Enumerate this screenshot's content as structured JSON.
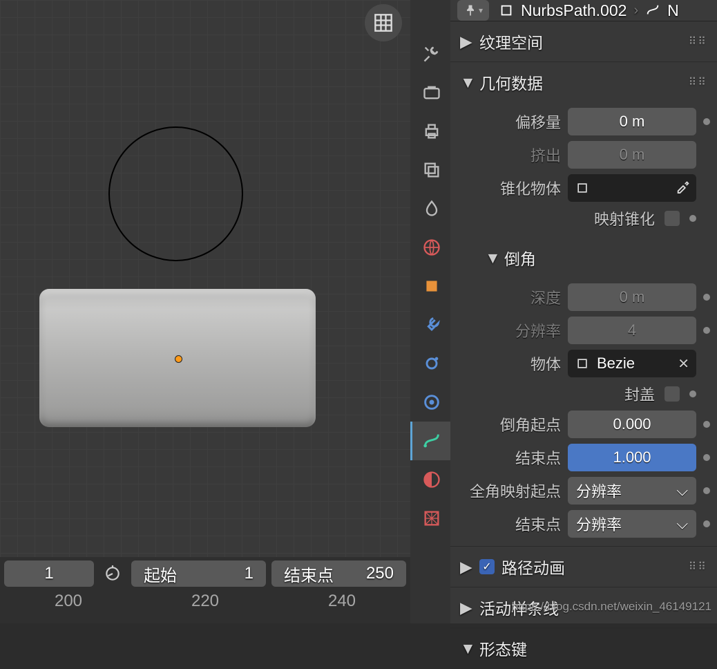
{
  "header": {
    "object_name": "NurbsPath.002",
    "next_char": "N"
  },
  "panels": {
    "texture_space": "纹理空间",
    "geometry": "几何数据",
    "bevel": "倒角",
    "path_anim": "路径动画",
    "active_spline": "活动样条线",
    "shape_keys": "形态键"
  },
  "geometry": {
    "offset_label": "偏移量",
    "offset_value": "0 m",
    "extrude_label": "挤出",
    "extrude_value": "0 m",
    "taper_label": "锥化物体",
    "map_taper_label": "映射锥化"
  },
  "bevel": {
    "depth_label": "深度",
    "depth_value": "0 m",
    "res_label": "分辨率",
    "res_value": "4",
    "object_label": "物体",
    "object_value": "Bezie",
    "cap_label": "封盖",
    "start_label": "倒角起点",
    "start_value": "0.000",
    "end_label": "结束点",
    "end_value": "1.000",
    "map_start_label": "全角映射起点",
    "map_start_value": "分辨率",
    "map_end_label": "结束点",
    "map_end_value": "分辨率"
  },
  "timeline": {
    "current": "1",
    "start_label": "起始",
    "start_value": "1",
    "end_label": "结束点",
    "end_value": "250",
    "ticks": [
      "200",
      "220",
      "240"
    ]
  },
  "watermark": "https://blog.csdn.net/weixin_46149121"
}
